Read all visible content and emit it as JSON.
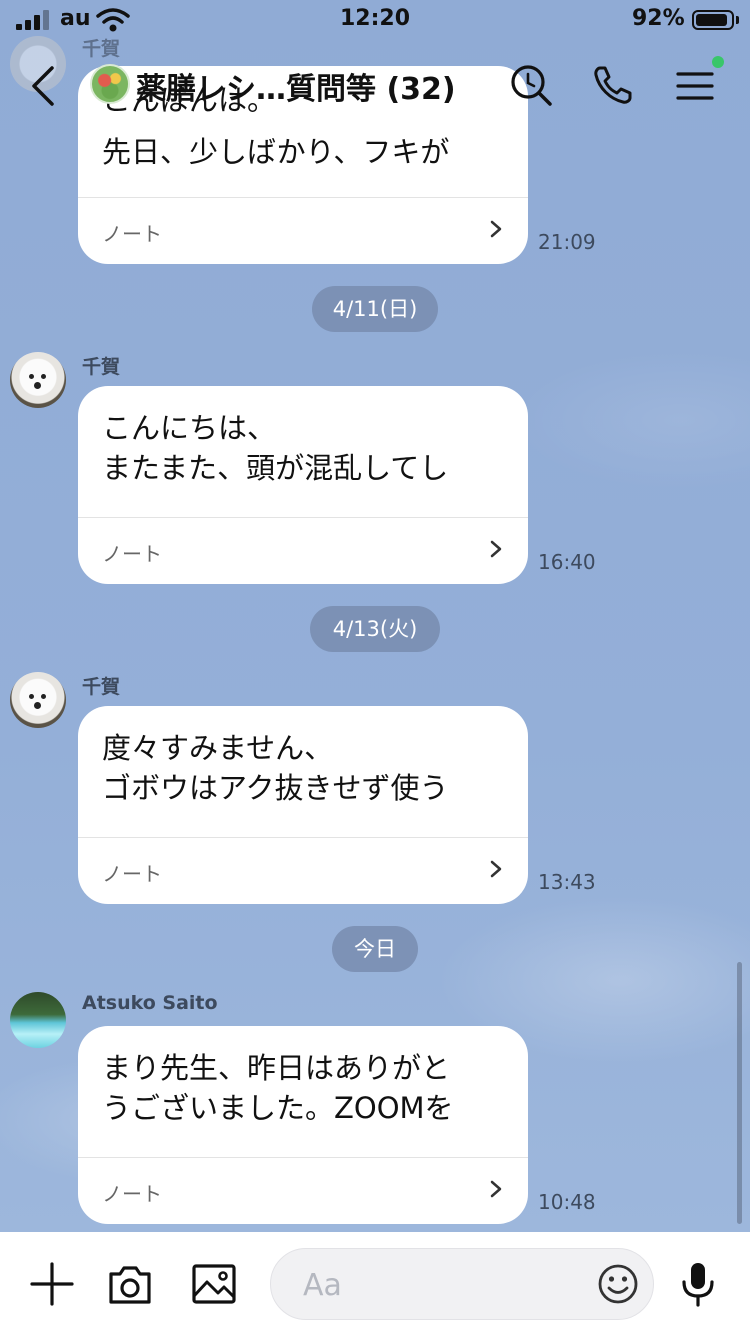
{
  "status": {
    "carrier": "au",
    "time": "12:20",
    "battery": "92%",
    "battery_level": 0.92
  },
  "header": {
    "title": "薬膳レシ…質問等 (32)"
  },
  "messages": [
    {
      "sender": "千賀",
      "lines": [
        "こんばんは。",
        "先日、少しばかり、フキが"
      ],
      "note": "ノート",
      "time": "21:09"
    },
    {
      "date": "4/11(日)",
      "sender": "千賀",
      "lines": [
        "こんにちは、",
        "またまた、頭が混乱してし"
      ],
      "note": "ノート",
      "time": "16:40"
    },
    {
      "date": "4/13(火)",
      "sender": "千賀",
      "lines": [
        "度々すみません、",
        "ゴボウはアク抜きせず使う"
      ],
      "note": "ノート",
      "time": "13:43"
    },
    {
      "date": "今日",
      "sender": "Atsuko Saito",
      "lines": [
        "まり先生、昨日はありがと",
        "うございました。ZOOMを"
      ],
      "note": "ノート",
      "time": "10:48"
    }
  ],
  "input": {
    "placeholder": "Aa"
  },
  "icons": {
    "back": "chevron-left-icon",
    "search": "search-icon",
    "call": "phone-icon",
    "menu": "menu-icon",
    "plus": "plus-icon",
    "camera": "camera-icon",
    "image": "image-icon",
    "emoji": "emoji-icon",
    "mic": "microphone-icon"
  },
  "colors": {
    "background": "#93aed6",
    "bubble": "#ffffff",
    "date_pill": "#788caf",
    "online": "#39c66a"
  }
}
